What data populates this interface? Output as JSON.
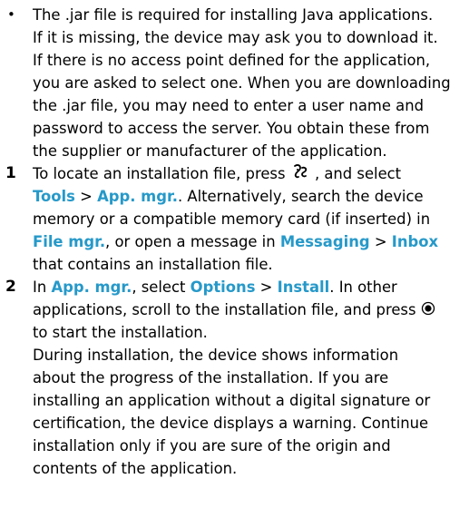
{
  "bullet_section": {
    "bullet": "•",
    "lines": [
      "The .jar file is required for installing Java applications.",
      "If it is missing, the device may ask you to download it.",
      "If there is no access point defined for the application,",
      "you are asked to select one. When you are downloading",
      "the .jar file, you may need to enter a user name and",
      "password to access the server. You obtain these from",
      "the supplier or manufacturer of the application."
    ]
  },
  "step1": {
    "number": "1",
    "l1_before": "To locate an installation file, press ",
    "l1_after": ", and select",
    "tools": "Tools",
    "sep1": " > ",
    "app_mgr": "App. mgr.",
    "l2_after": ". Alternatively, search the device",
    "l3": "memory or a compatible memory card (if inserted) in",
    "file_mgr": "File mgr.",
    "l4_mid": ", or open a message in ",
    "messaging": "Messaging",
    "sep2": " > ",
    "inbox": "Inbox",
    "l5": "that contains an installation file."
  },
  "step2": {
    "number": "2",
    "l1_in": "In ",
    "app_mgr": "App. mgr.",
    "l1_select": ", select ",
    "options": "Options",
    "sep": " > ",
    "install": "Install",
    "l1_end": ". In other",
    "l2": "applications, scroll to the installation file, and press",
    "l3": "to start the installation.",
    "para2": [
      "During installation, the device shows information",
      "about the progress of the installation. If you are",
      "installing an application without a digital signature or",
      "certification, the device displays a warning. Continue",
      "installation only if you are sure of the origin and",
      "contents of the application."
    ]
  },
  "icons": {
    "menu_key": "menu-key-icon",
    "selection_key": "selection-key-icon"
  },
  "colors": {
    "highlight": "#2699c9",
    "text": "#000000"
  }
}
